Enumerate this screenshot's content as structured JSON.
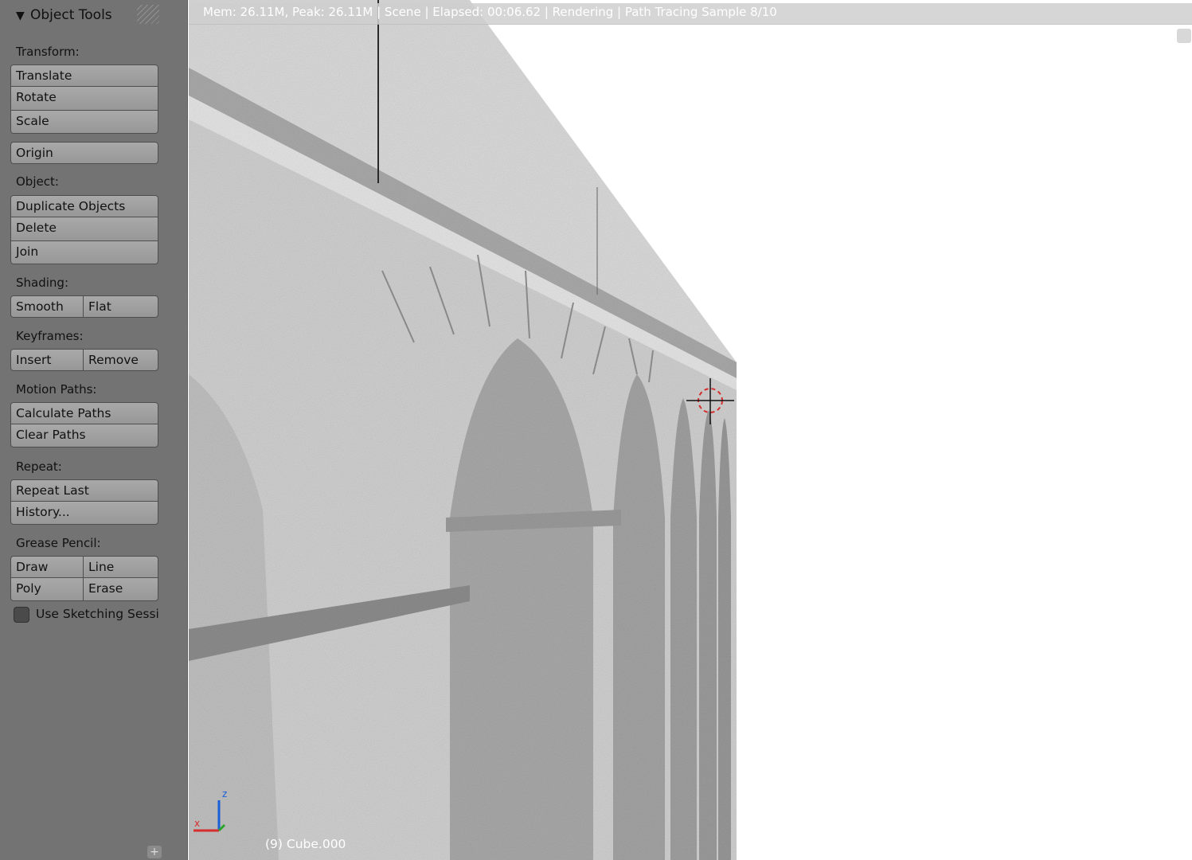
{
  "panel": {
    "title": "Object Tools",
    "sections": {
      "transform": {
        "label": "Transform:",
        "translate": "Translate",
        "rotate": "Rotate",
        "scale": "Scale",
        "origin": "Origin"
      },
      "object": {
        "label": "Object:",
        "duplicate": "Duplicate Objects",
        "delete": "Delete",
        "join": "Join"
      },
      "shading": {
        "label": "Shading:",
        "smooth": "Smooth",
        "flat": "Flat"
      },
      "keyframes": {
        "label": "Keyframes:",
        "insert": "Insert",
        "remove": "Remove"
      },
      "motion_paths": {
        "label": "Motion Paths:",
        "calculate": "Calculate Paths",
        "clear": "Clear Paths"
      },
      "repeat": {
        "label": "Repeat:",
        "repeat_last": "Repeat Last",
        "history": "History..."
      },
      "grease_pencil": {
        "label": "Grease Pencil:",
        "draw": "Draw",
        "line": "Line",
        "poly": "Poly",
        "erase": "Erase",
        "use_sketching": "Use Sketching Sessi"
      }
    }
  },
  "viewport": {
    "status": "Mem: 26.11M, Peak: 26.11M | Scene | Elapsed: 00:06.62 | Rendering | Path Tracing Sample 8/10",
    "object_name": "(9) Cube.000",
    "axis_z": "z",
    "axis_x": "x"
  },
  "colors": {
    "panel_bg": "#737373",
    "button_bg": "#a0a0a0",
    "axis_x": "#d62d2d",
    "axis_z": "#1a5fd6",
    "cursor_ring": "#d62d2d"
  }
}
